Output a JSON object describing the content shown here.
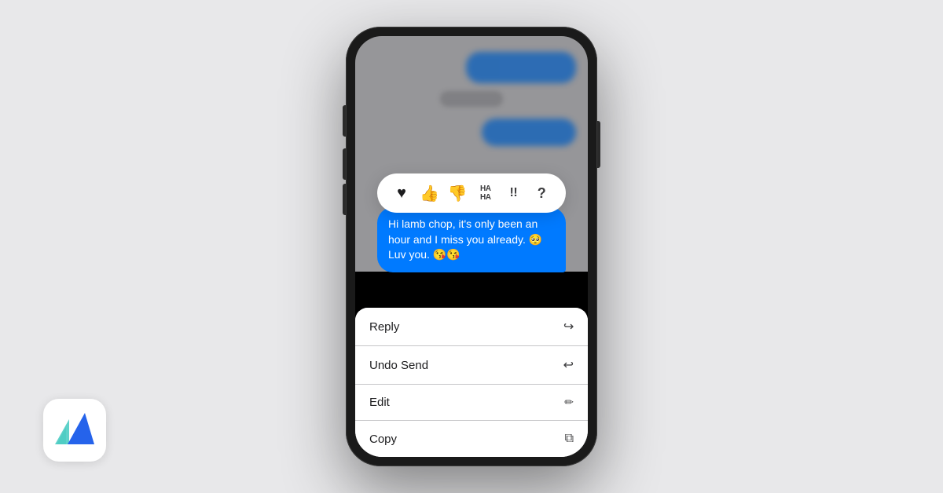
{
  "brand": {
    "alt": "Brand Logo"
  },
  "phone": {
    "message_text": "Hi lamb chop, it's only been an hour and I miss you already. 🥺 Luv you. 😘😘",
    "reactions": [
      {
        "id": "heart",
        "label": "❤️",
        "type": "emoji"
      },
      {
        "id": "thumbsup",
        "label": "👍",
        "type": "emoji"
      },
      {
        "id": "thumbsdown",
        "label": "👎",
        "type": "emoji"
      },
      {
        "id": "haha",
        "label": "HA\nHA",
        "type": "text"
      },
      {
        "id": "emphasis",
        "label": "‼",
        "type": "text"
      },
      {
        "id": "question",
        "label": "?",
        "type": "text"
      }
    ],
    "context_menu": {
      "items": [
        {
          "id": "reply",
          "label": "Reply",
          "icon": "↩"
        },
        {
          "id": "undo-send",
          "label": "Undo Send",
          "icon": "↩"
        },
        {
          "id": "edit",
          "label": "Edit",
          "icon": "✏"
        },
        {
          "id": "copy",
          "label": "Copy",
          "icon": "⧉"
        }
      ]
    }
  },
  "colors": {
    "accent_blue": "#007AFF",
    "text_dark": "#1c1c1e",
    "separator": "#c6c6c8"
  }
}
